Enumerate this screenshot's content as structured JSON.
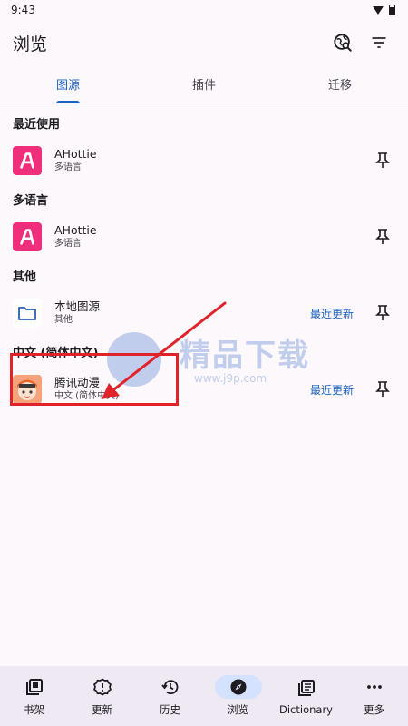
{
  "status": {
    "time": "9:43"
  },
  "header": {
    "title": "浏览"
  },
  "tabs": [
    {
      "label": "图源",
      "active": true
    },
    {
      "label": "插件",
      "active": false
    },
    {
      "label": "迁移",
      "active": false
    }
  ],
  "sections": [
    {
      "title": "最近使用",
      "items": [
        {
          "name": "AHottie",
          "lang": "多语言",
          "latest": ""
        }
      ]
    },
    {
      "title": "多语言",
      "items": [
        {
          "name": "AHottie",
          "lang": "多语言",
          "latest": ""
        }
      ]
    },
    {
      "title": "其他",
      "items": [
        {
          "name": "本地图源",
          "lang": "其他",
          "latest": "最近更新"
        }
      ]
    },
    {
      "title": "中文 (简体中文)",
      "items": [
        {
          "name": "腾讯动漫",
          "lang": "中文 (简体中文)",
          "latest": "最近更新"
        }
      ]
    }
  ],
  "watermark": {
    "text": "精品下载",
    "sub": "www.j9p.com"
  },
  "bottom_nav": [
    {
      "label": "书架",
      "icon": "bookshelf-icon",
      "active": false
    },
    {
      "label": "更新",
      "icon": "updates-icon",
      "active": false
    },
    {
      "label": "历史",
      "icon": "history-icon",
      "active": false
    },
    {
      "label": "浏览",
      "icon": "compass-icon",
      "active": true
    },
    {
      "label": "Dictionary",
      "icon": "dictionary-icon",
      "active": false
    },
    {
      "label": "更多",
      "icon": "more-icon",
      "active": false
    }
  ],
  "colors": {
    "accent": "#1b63c4",
    "highlight": "#e0222a",
    "ahottie": "#ef2f7c"
  }
}
